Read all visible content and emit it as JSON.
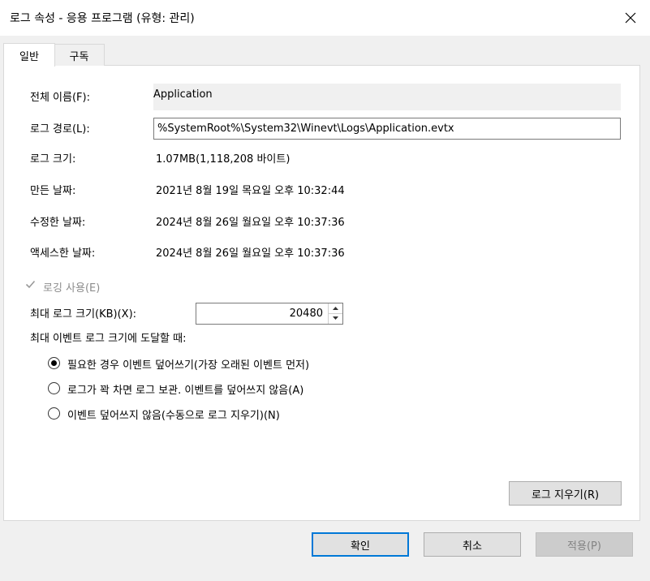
{
  "window": {
    "title": "로그 속성 - 응용 프로그램 (유형: 관리)"
  },
  "tabs": [
    {
      "label": "일반",
      "active": true
    },
    {
      "label": "구독",
      "active": false
    }
  ],
  "general": {
    "full_name_label": "전체 이름(F):",
    "full_name_value": "Application",
    "log_path_label": "로그 경로(L):",
    "log_path_value": "%SystemRoot%\\System32\\Winevt\\Logs\\Application.evtx",
    "log_size_label": "로그 크기:",
    "log_size_value": "1.07MB(1,118,208 바이트)",
    "created_label": "만든 날짜:",
    "created_value": "2021년 8월 19일 목요일 오후 10:32:44",
    "modified_label": "수정한 날짜:",
    "modified_value": "2024년 8월 26일 월요일 오후 10:37:36",
    "accessed_label": "액세스한 날짜:",
    "accessed_value": "2024년 8월 26일 월요일 오후 10:37:36",
    "enable_logging_label": "로깅 사용(E)",
    "enable_logging_checked": true,
    "max_size_label": "최대 로그 크기(KB)(X):",
    "max_size_value": "20480",
    "when_max_label": "최대 이벤트 로그 크기에 도달할 때:",
    "options": [
      {
        "label": "필요한 경우 이벤트 덮어쓰기(가장 오래된 이벤트 먼저)",
        "selected": true
      },
      {
        "label": "로그가 꽉 차면 로그 보관. 이벤트를 덮어쓰지 않음(A)",
        "selected": false
      },
      {
        "label": "이벤트 덮어쓰지 않음(수동으로 로그 지우기)(N)",
        "selected": false
      }
    ],
    "clear_log_label": "로그 지우기(R)"
  },
  "footer": {
    "ok_label": "확인",
    "cancel_label": "취소",
    "apply_label": "적용(P)"
  },
  "colors": {
    "accent": "#0078d7",
    "panel_bg": "#ffffff",
    "dialog_bg": "#f0f0f0",
    "disabled_text": "#8c8c8c"
  }
}
